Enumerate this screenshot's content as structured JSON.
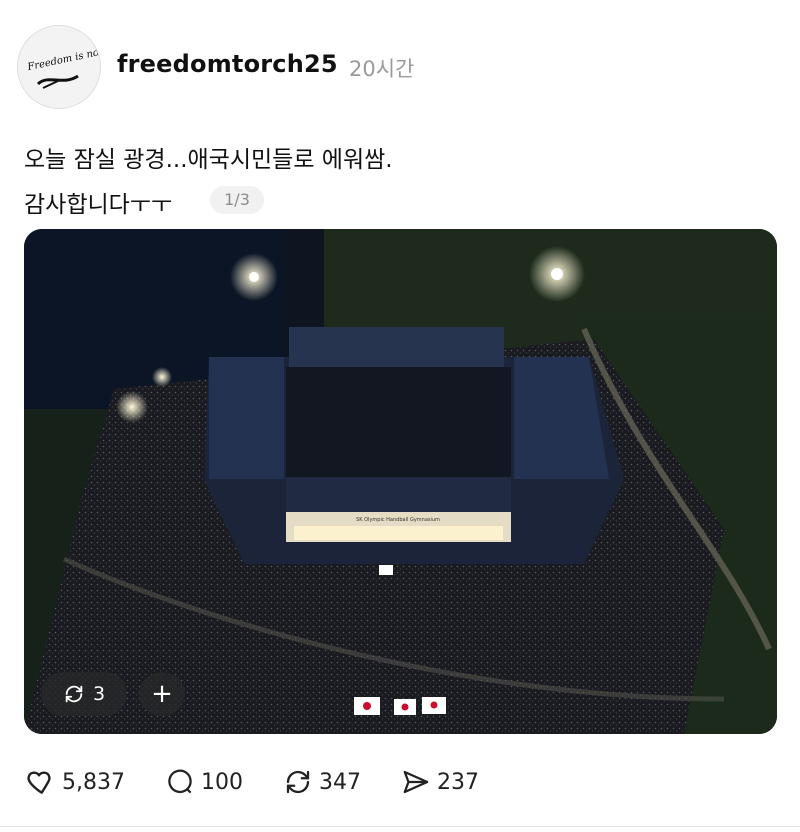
{
  "post": {
    "username": "freedomtorch25",
    "timestamp": "20시간",
    "avatar_text": "Freedom is not Free",
    "text_line1": "오늘 잠실 광경...애국시민들로 에워쌈.",
    "text_line2": "감사합니다ㅜㅜ",
    "page_indicator": "1/3"
  },
  "photo": {
    "arena_sign": "SK Olympic Handball Gymnasium",
    "repost_count": "3",
    "plus_label": "+"
  },
  "actions": {
    "likes": "5,837",
    "comments": "100",
    "reposts": "347",
    "shares": "237"
  },
  "colors": {
    "text": "#111111",
    "muted": "#9a9a9a",
    "pill_bg": "#f1f1f1"
  }
}
